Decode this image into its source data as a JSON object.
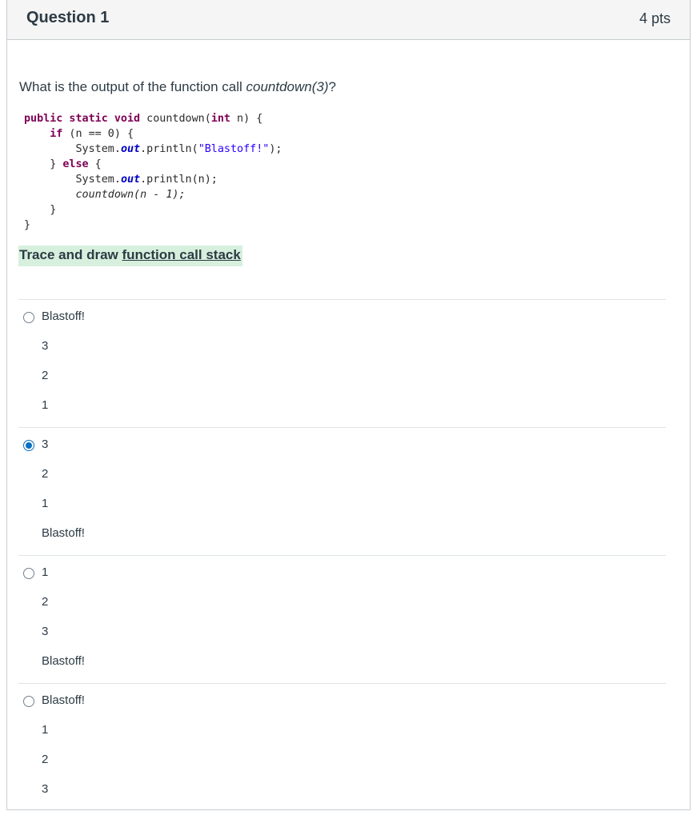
{
  "question": {
    "title": "Question 1",
    "points": "4 pts",
    "prompt_text": "What is the output of the function call ",
    "prompt_call": "countdown(3)",
    "prompt_end": "?"
  },
  "code": {
    "l1_kw": "public static void",
    "l1_rest": " countdown(",
    "l1_kw2": "int",
    "l1_end": " n) {",
    "l2_kw": "if",
    "l2_rest": " (n == 0) {",
    "l3_a": "System.",
    "l3_out": "out",
    "l3_b": ".println(",
    "l3_str": "\"Blastoff!\"",
    "l3_c": ");",
    "l4_a": "} ",
    "l4_kw": "else",
    "l4_b": " {",
    "l5_a": "System.",
    "l5_out": "out",
    "l5_b": ".println(n);",
    "l6": "countdown(n - 1);",
    "l7": "}",
    "l8": "}"
  },
  "hint": {
    "text": "Trace and draw ",
    "link": "function call stack"
  },
  "answers": [
    {
      "selected": false,
      "lines": [
        "Blastoff!",
        "3",
        "2",
        "1"
      ]
    },
    {
      "selected": true,
      "lines": [
        "3",
        "2",
        "1",
        "Blastoff!"
      ]
    },
    {
      "selected": false,
      "lines": [
        "1",
        "2",
        "3",
        "Blastoff!"
      ]
    },
    {
      "selected": false,
      "lines": [
        "Blastoff!",
        "1",
        "2",
        "3"
      ]
    }
  ]
}
